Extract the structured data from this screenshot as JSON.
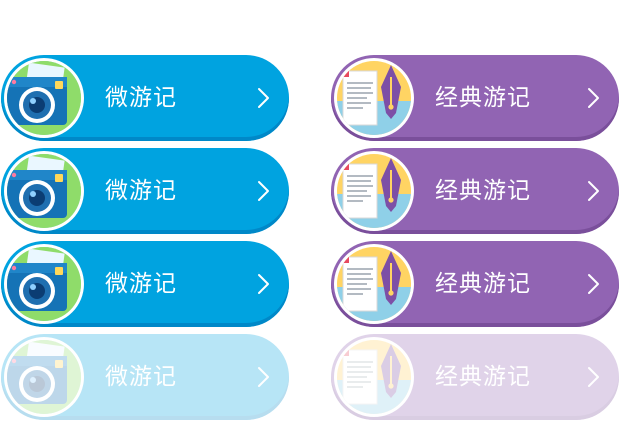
{
  "colors": {
    "blue": "#00a3e0",
    "blue_shadow": "#0088c8",
    "purple": "#9164b3",
    "purple_shadow": "#7a4f9b"
  },
  "buttons": [
    {
      "label": "微游记",
      "style": "blue",
      "state": "normal",
      "icon": "camera-icon"
    },
    {
      "label": "经典游记",
      "style": "purple",
      "state": "normal",
      "icon": "document-pen-icon"
    },
    {
      "label": "微游记",
      "style": "blue",
      "state": "normal",
      "icon": "camera-icon"
    },
    {
      "label": "经典游记",
      "style": "purple",
      "state": "normal",
      "icon": "document-pen-icon"
    },
    {
      "label": "微游记",
      "style": "blue",
      "state": "normal",
      "icon": "camera-icon"
    },
    {
      "label": "经典游记",
      "style": "purple",
      "state": "normal",
      "icon": "document-pen-icon"
    },
    {
      "label": "微游记",
      "style": "blue",
      "state": "disabled",
      "icon": "camera-icon"
    },
    {
      "label": "经典游记",
      "style": "purple",
      "state": "disabled",
      "icon": "document-pen-icon"
    }
  ]
}
